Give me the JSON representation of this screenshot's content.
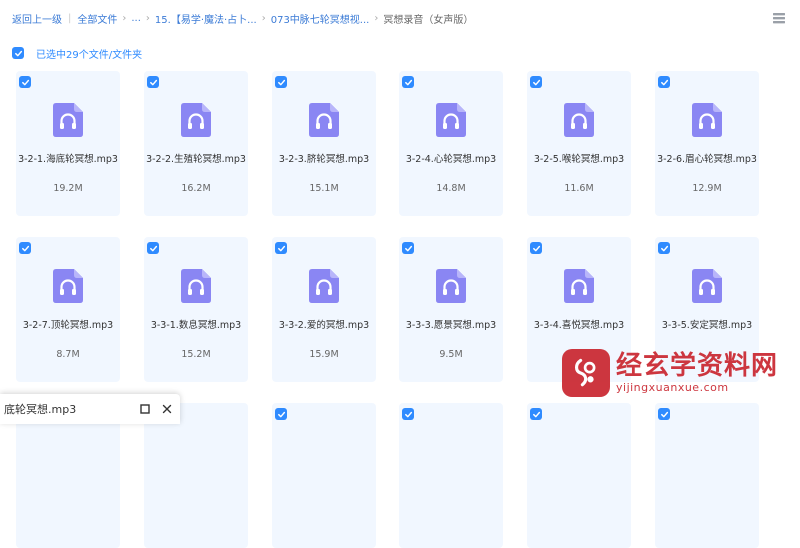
{
  "breadcrumb": {
    "back": "返回上一级",
    "all_files": "全部文件",
    "ellipsis": "...",
    "folder1": "15.【易学·魔法·占卜...",
    "folder2": "073中脉七轮冥想视...",
    "current": "冥想录音（女声版）"
  },
  "selection": {
    "label": "已选中29个文件/文件夹"
  },
  "files": [
    {
      "name": "3-2-1.海底轮冥想.mp3",
      "size": "19.2M"
    },
    {
      "name": "3-2-2.生殖轮冥想.mp3",
      "size": "16.2M"
    },
    {
      "name": "3-2-3.脐轮冥想.mp3",
      "size": "15.1M"
    },
    {
      "name": "3-2-4.心轮冥想.mp3",
      "size": "14.8M"
    },
    {
      "name": "3-2-5.喉轮冥想.mp3",
      "size": "11.6M"
    },
    {
      "name": "3-2-6.眉心轮冥想.mp3",
      "size": "12.9M"
    },
    {
      "name": "3-2-7.顶轮冥想.mp3",
      "size": "8.7M"
    },
    {
      "name": "3-3-1.数息冥想.mp3",
      "size": "15.2M"
    },
    {
      "name": "3-3-2.爱的冥想.mp3",
      "size": "15.9M"
    },
    {
      "name": "3-3-3.愿景冥想.mp3",
      "size": "9.5M"
    },
    {
      "name": "3-3-4.喜悦冥想.mp3",
      "size": ""
    },
    {
      "name": "3-3-5.安定冥想.mp3",
      "size": ""
    }
  ],
  "download_bar": {
    "filename": "底轮冥想.mp3"
  },
  "watermark": {
    "text": "经玄学资料网",
    "url": "yijingxuanxue.com"
  },
  "colors": {
    "accent": "#2f8bff",
    "card_bg": "#f1f7ff",
    "icon": "#8a86f3",
    "watermark": "#c9262f"
  }
}
